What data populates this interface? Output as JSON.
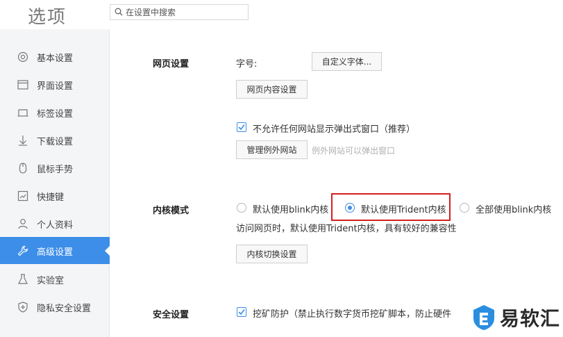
{
  "header": {
    "title": "选项",
    "search_placeholder": "在设置中搜索"
  },
  "sidebar": {
    "items": [
      {
        "label": "基本设置",
        "icon": "gear-icon"
      },
      {
        "label": "界面设置",
        "icon": "window-icon"
      },
      {
        "label": "标签设置",
        "icon": "tab-icon"
      },
      {
        "label": "下载设置",
        "icon": "download-icon"
      },
      {
        "label": "鼠标手势",
        "icon": "mouse-icon"
      },
      {
        "label": "快捷键",
        "icon": "shortcut-icon"
      },
      {
        "label": "个人资料",
        "icon": "person-icon"
      },
      {
        "label": "高级设置",
        "icon": "wrench-icon",
        "active": true
      },
      {
        "label": "实验室",
        "icon": "flask-icon"
      },
      {
        "label": "隐私安全设置",
        "icon": "shield-icon"
      }
    ]
  },
  "webpage": {
    "section_label": "网页设置",
    "font_size_label": "字号:",
    "custom_font_button": "自定义字体...",
    "content_settings_button": "网页内容设置",
    "popup_checkbox_label": "不允许任何网站显示弹出式窗口（推荐）",
    "popup_checked": true,
    "manage_exceptions_button": "管理例外网站",
    "exceptions_hint": "例外网站可以弹出窗口"
  },
  "kernel": {
    "section_label": "内核模式",
    "options": [
      {
        "label": "默认使用blink内核",
        "checked": false
      },
      {
        "label": "默认使用Trident内核",
        "checked": true
      },
      {
        "label": "全部使用blink内核",
        "checked": false
      }
    ],
    "description": "访问网页时，默认使用Trident内核，具有较好的兼容性",
    "switch_button": "内核切换设置"
  },
  "security": {
    "section_label": "安全设置",
    "mining_checkbox_label": "挖矿防护（禁止执行数字货币挖矿脚本，防止硬件",
    "mining_checked": true
  },
  "watermark": {
    "text": "易软汇"
  },
  "colors": {
    "accent": "#3d8ee8",
    "highlight": "#d42020",
    "sidebar_bg": "#f4f5f7"
  }
}
